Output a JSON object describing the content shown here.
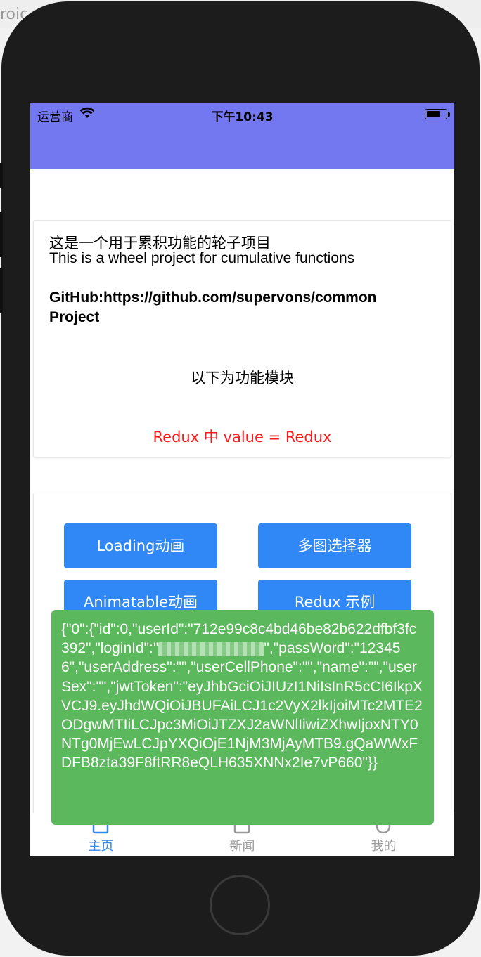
{
  "background": {
    "window_title_fragment": "roic"
  },
  "status_bar": {
    "carrier": "运营商",
    "time": "下午10:43",
    "color": "#7478f0"
  },
  "intro": {
    "line_cn": "这是一个用于累积功能的轮子项目",
    "line_en": "This is a wheel project for cumulative functions",
    "github": "GitHub:https://github.com/supervons/commonProject",
    "modules_heading": "以下为功能模块",
    "redux_value": "Redux 中 value = Redux"
  },
  "buttons": {
    "loading": "Loading动画",
    "image_picker": "多图选择器",
    "animatable": "Animatable动画",
    "redux_example": "Redux 示例",
    "color": "#2f88f5"
  },
  "toast": {
    "text_before": "{\"0\":{\"id\":0,\"userId\":\"712e99c8c4bd46be82b622dfbf3fc392\",\"loginId\":\"",
    "text_after": "\",\"passWord\":\"123456\",\"userAddress\":\"\",\"userCellPhone\":\"\",\"name\":\"\",\"userSex\":\"\",\"jwtToken\":\"eyJhbGciOiJIUzI1NiIsInR5cCI6IkpXVCJ9.eyJhdWQiOiJBUFAiLCJ1c2VyX2lkIjoiMTc2MTE2ODgwMTIiLCJpc3MiOiJTZXJ2aWNlIiwiZXhwIjoxNTY0NTg0MjEwLCJpYXQiOjE1NjM3MjAyMTB9.gQaWWxFDFB8zta39F8ftRR8eQLH635XNNx2Ie7vP660\"}}",
    "color": "#5cb85c"
  },
  "tabbar": {
    "home": "主页",
    "news": "新闻",
    "mine": "我的",
    "active_color": "#2f88f5"
  }
}
